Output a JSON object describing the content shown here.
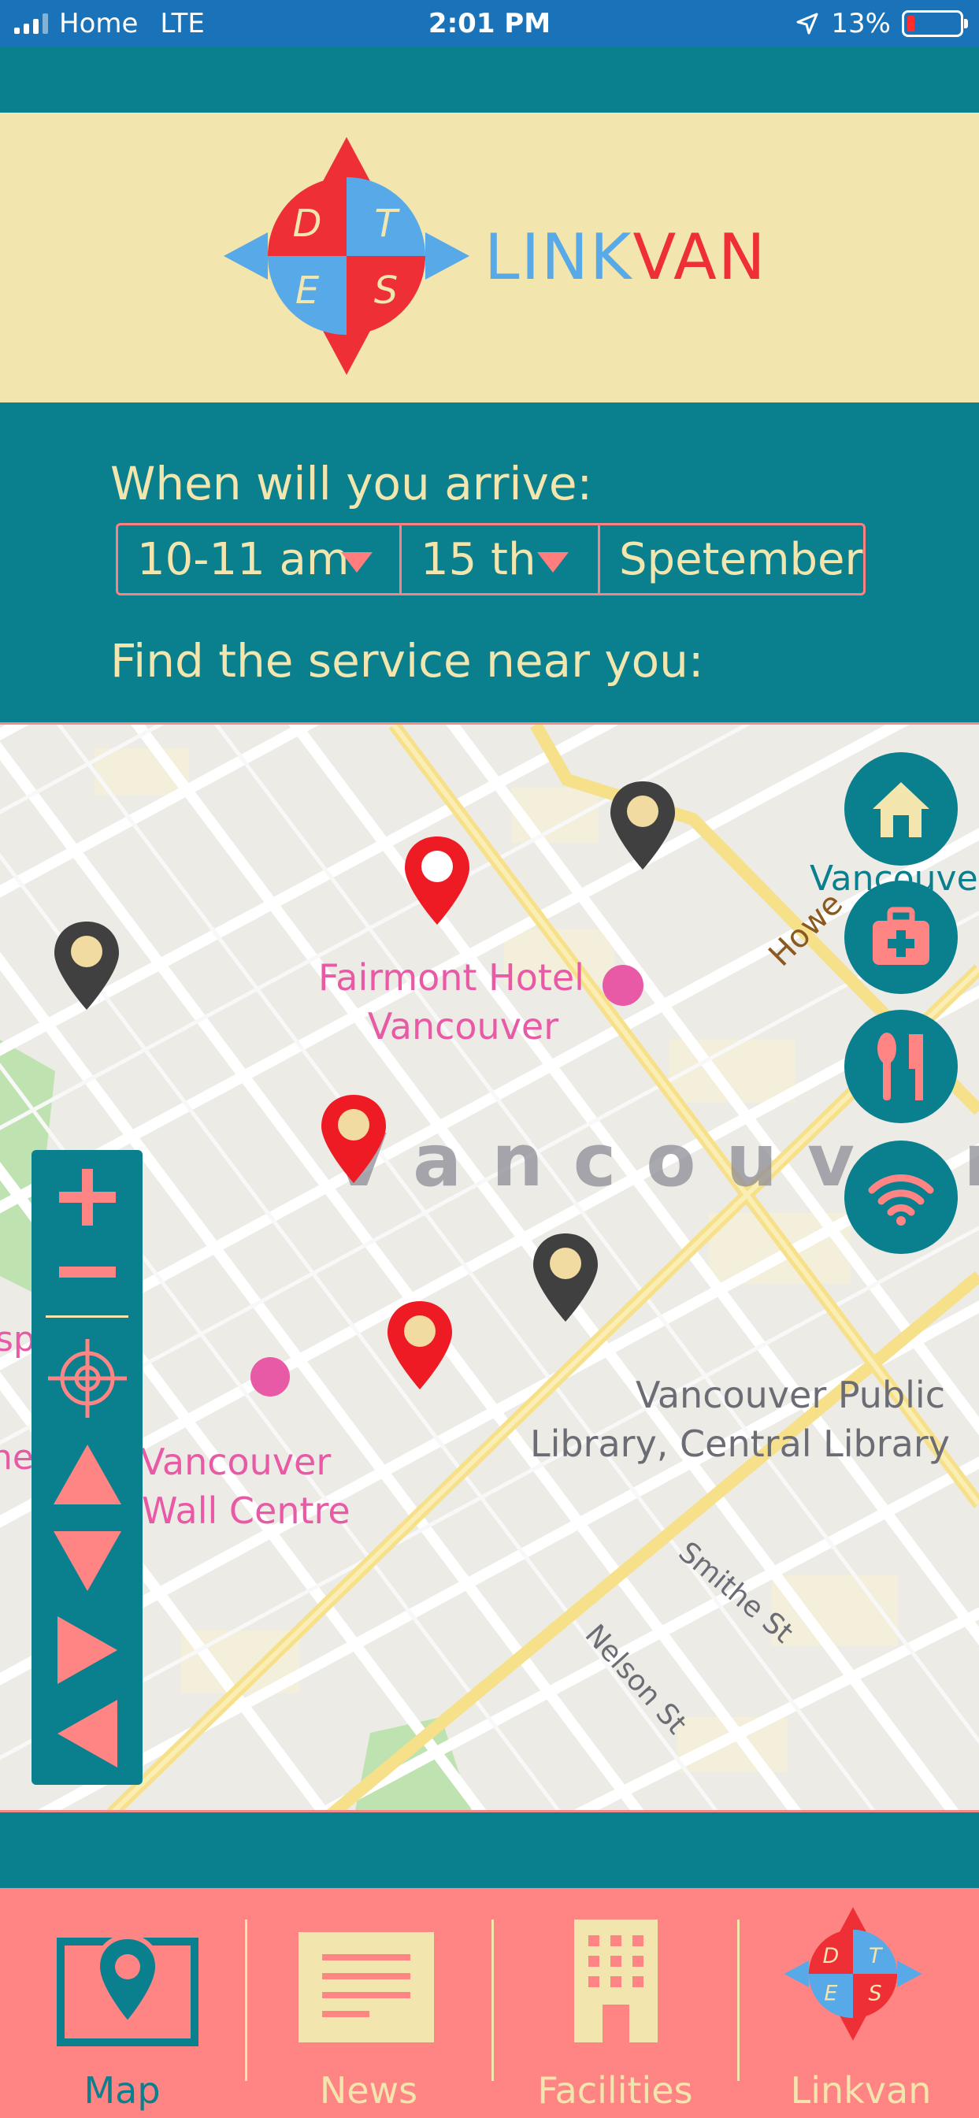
{
  "status_bar": {
    "carrier": "Home",
    "network": "LTE",
    "time": "2:01 PM",
    "battery": "13%",
    "battery_level": 0.13
  },
  "header": {
    "logo_letters": [
      "D",
      "T",
      "E",
      "S"
    ],
    "brand_part1": "LINK",
    "brand_part2": "VAN",
    "colors": {
      "brand_blue": "#58a9e8",
      "brand_red": "#ee2f35",
      "cream": "#f2e5ad",
      "teal": "#0a7f8e",
      "coral": "#ff8585"
    }
  },
  "arrival": {
    "label": "When will you arrive:",
    "time_slot": "10-11 am",
    "day": "15 th",
    "month": "Spetember"
  },
  "find_label": "Find the service near you:",
  "map": {
    "labels": {
      "fairmont_line1": "Fairmont Hotel",
      "fairmont_line2": "Vancouver",
      "city": "Vancouver",
      "library_line1": "Vancouver Public",
      "library_line2": "Library, Central Library",
      "wall_centre_line1": "Vancouver",
      "wall_centre_line2": "Wall Centre",
      "smithe": "Smithe St",
      "nelson": "Nelson St",
      "howe": "Howe",
      "vancouver_edge": "Vancouve",
      "sp_edge": "sp",
      "he_edge": "he"
    },
    "side_buttons": [
      {
        "name": "home-icon"
      },
      {
        "name": "medical-kit-icon"
      },
      {
        "name": "food-icon"
      },
      {
        "name": "wifi-icon"
      }
    ],
    "controls": [
      "zoom-in",
      "zoom-out",
      "locate",
      "pan-up",
      "pan-down",
      "pan-right",
      "pan-left"
    ]
  },
  "nav": {
    "items": [
      {
        "label": "Map",
        "icon": "map-pin-icon",
        "active": true
      },
      {
        "label": "News",
        "icon": "news-icon",
        "active": false
      },
      {
        "label": "Facilities",
        "icon": "building-icon",
        "active": false
      },
      {
        "label": "Linkvan",
        "icon": "linkvan-logo-icon",
        "active": false
      }
    ]
  }
}
